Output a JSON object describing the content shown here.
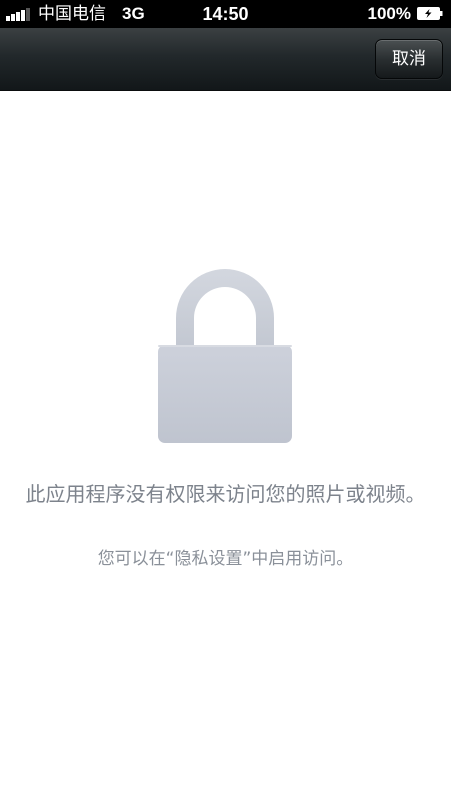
{
  "status_bar": {
    "carrier": "中国电信",
    "network": "3G",
    "time": "14:50",
    "battery_percent": "100%",
    "icons": [
      "signal-icon",
      "battery-icon"
    ]
  },
  "nav_bar": {
    "cancel_label": "取消"
  },
  "content": {
    "icon": "lock-icon",
    "message": "此应用程序没有权限来访问您的照片或视频。",
    "hint": "您可以在“隐私设置”中启用访问。"
  },
  "colors": {
    "nav_background": "#22282b",
    "lock_color": "#c8ccd6",
    "message_text": "#7d838c"
  }
}
